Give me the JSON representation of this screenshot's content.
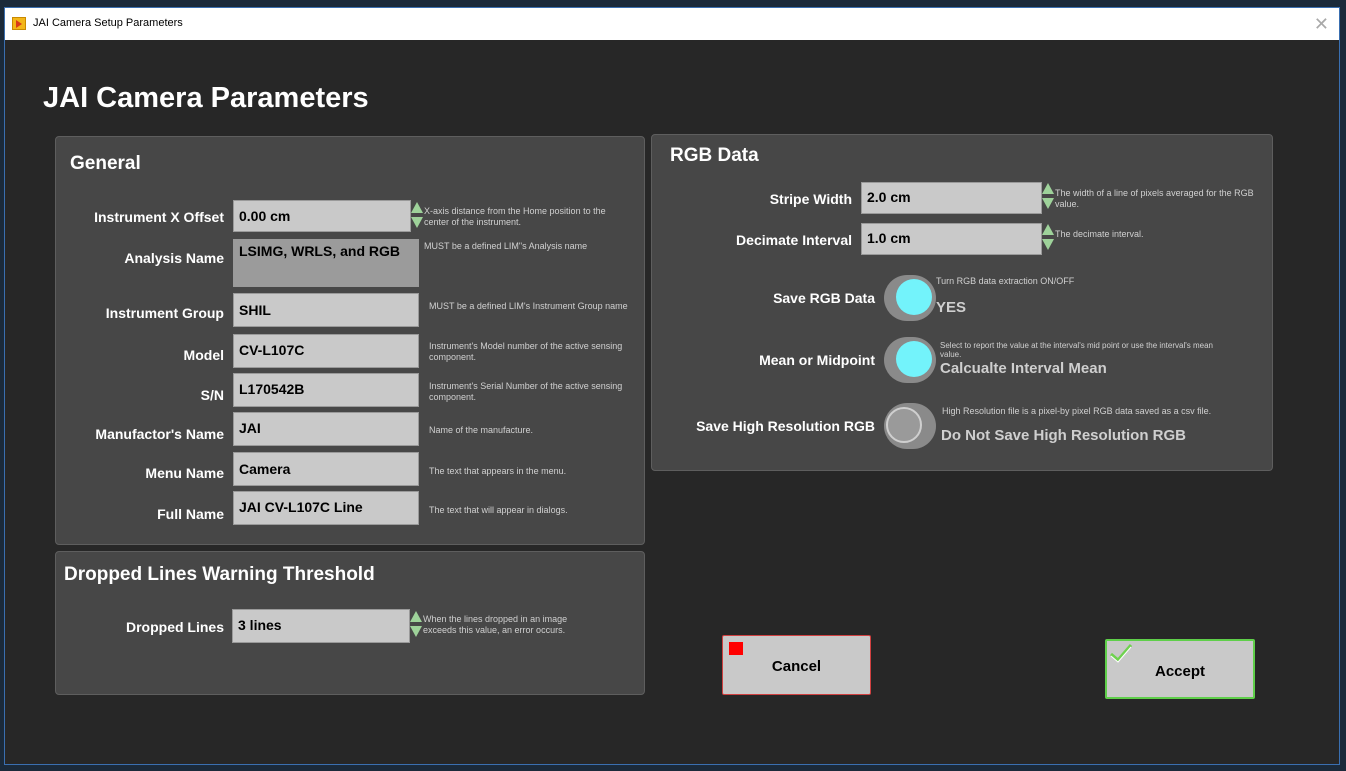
{
  "window": {
    "title": "JAI Camera Setup Parameters"
  },
  "heading": "JAI Camera Parameters",
  "general": {
    "title": "General",
    "fields": [
      {
        "label": "Instrument X Offset",
        "value": "0.00 cm",
        "desc": "X-axis distance from the Home position to the center of the instrument."
      },
      {
        "label": "Analysis Name",
        "value": "LSIMG, WRLS, and RGB",
        "desc": "MUST be a defined LIM\"s Analysis name"
      },
      {
        "label": "Instrument Group",
        "value": "SHIL",
        "desc": "MUST be a defined LIM's Instrument Group name"
      },
      {
        "label": "Model",
        "value": "CV-L107C",
        "desc": "Instrument's Model number of the active sensing component."
      },
      {
        "label": "S/N",
        "value": "L170542B",
        "desc": "Instrument's Serial Number of the active sensing component."
      },
      {
        "label": "Manufactor's Name",
        "value": "JAI",
        "desc": "Name of the manufacture."
      },
      {
        "label": "Menu Name",
        "value": "Camera",
        "desc": "The text that appears in the menu."
      },
      {
        "label": "Full Name",
        "value": "JAI CV-L107C Line",
        "desc": "The text that will appear in dialogs."
      }
    ]
  },
  "dropped": {
    "title": "Dropped Lines Warning Threshold",
    "label": "Dropped Lines",
    "value": "3 lines",
    "desc": "When the lines dropped in an image exceeds this value, an error occurs."
  },
  "rgb": {
    "title": "RGB Data",
    "stripe_label": "Stripe Width",
    "stripe_value": "2.0 cm",
    "stripe_desc": "The width of a line of pixels averaged for the RGB value.",
    "decimate_label": "Decimate Interval",
    "decimate_value": "1.0 cm",
    "decimate_desc": "The decimate interval.",
    "save_label": "Save RGB Data",
    "save_desc": "Turn RGB data extraction ON/OFF",
    "save_state": "YES",
    "mean_label": "Mean or Midpoint",
    "mean_desc": "Select to report the value at the interval's mid point or use the interval's mean value.",
    "mean_state": "Calcualte Interval Mean",
    "hires_label": "Save High Resolution RGB",
    "hires_desc": "High Resolution file is a pixel-by pixel RGB data saved as a csv file.",
    "hires_state": "Do Not Save High Resolution RGB"
  },
  "buttons": {
    "cancel": "Cancel",
    "accept": "Accept"
  },
  "colors": {
    "toggle_on": "#73f3fb",
    "spin_arrow": "#9ed29a",
    "accept_border": "#5fcf4a",
    "cancel_icon": "#ff0000"
  }
}
